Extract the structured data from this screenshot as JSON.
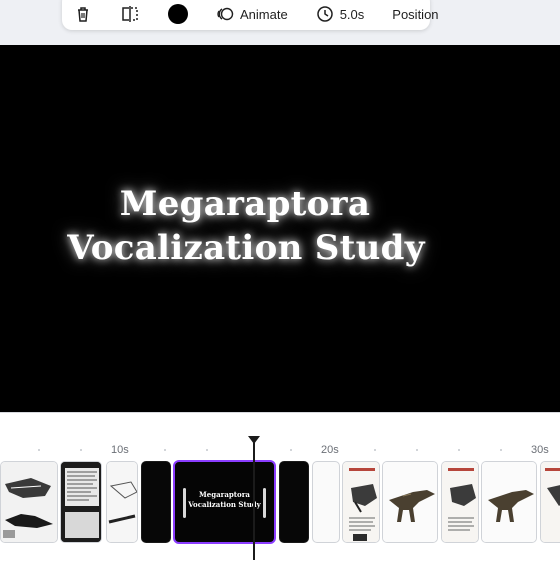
{
  "toolbar": {
    "animate_label": "Animate",
    "duration_label": "5.0s",
    "position_label": "Position",
    "color_swatch": "#000000",
    "icons": [
      "trash-icon",
      "flip-icon",
      "animate-icon",
      "clock-icon"
    ]
  },
  "canvas": {
    "title_line1": "Megaraptora",
    "title_line2": "Vocalization Study",
    "background": "#000000",
    "text_color": "#ffffff"
  },
  "timeline": {
    "ticks": [
      "10s",
      "20s",
      "30s"
    ],
    "selected_clip": {
      "title_line1": "Megaraptora",
      "title_line2": "Vocalization Study",
      "border_color": "#8b3dff"
    }
  }
}
